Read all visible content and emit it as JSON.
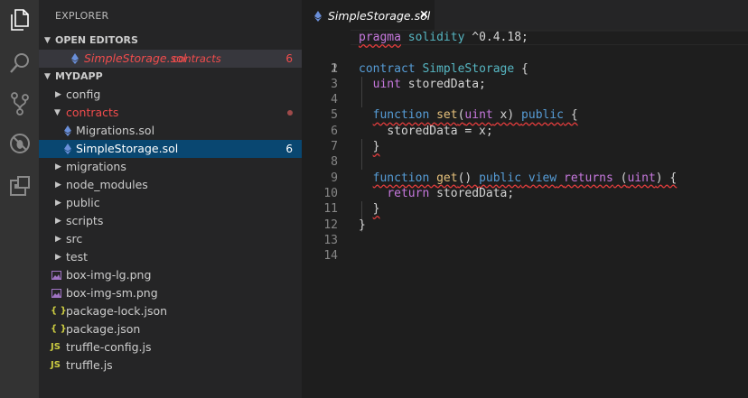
{
  "activity_bar": {
    "icons": [
      "files-icon",
      "search-icon",
      "source-control-icon",
      "debug-icon",
      "extensions-icon"
    ]
  },
  "explorer": {
    "title": "EXPLORER",
    "open_editors": {
      "header": "OPEN EDITORS",
      "items": [
        {
          "name": "SimpleStorage.sol",
          "folder": "contracts",
          "badge": "6"
        }
      ]
    },
    "project": {
      "header": "MYDAPP",
      "items": [
        {
          "label": "config",
          "type": "folder"
        },
        {
          "label": "contracts",
          "type": "folder-open"
        },
        {
          "label": "Migrations.sol",
          "type": "sol"
        },
        {
          "label": "SimpleStorage.sol",
          "type": "sol",
          "badge": "6"
        },
        {
          "label": "migrations",
          "type": "folder"
        },
        {
          "label": "node_modules",
          "type": "folder"
        },
        {
          "label": "public",
          "type": "folder"
        },
        {
          "label": "scripts",
          "type": "folder"
        },
        {
          "label": "src",
          "type": "folder"
        },
        {
          "label": "test",
          "type": "folder"
        },
        {
          "label": "box-img-lg.png",
          "type": "image"
        },
        {
          "label": "box-img-sm.png",
          "type": "image"
        },
        {
          "label": "package-lock.json",
          "type": "json"
        },
        {
          "label": "package.json",
          "type": "json"
        },
        {
          "label": "truffle-config.js",
          "type": "js"
        },
        {
          "label": "truffle.js",
          "type": "js"
        }
      ]
    },
    "icon_glyphs": {
      "json": "{ }",
      "js": "JS"
    }
  },
  "editor": {
    "tab": {
      "label": "SimpleStorage.sol",
      "close": "×"
    },
    "line_numbers": [
      "1",
      "2",
      "3",
      "4",
      "5",
      "6",
      "7",
      "8",
      "9",
      "10",
      "11",
      "12",
      "13",
      "14"
    ],
    "code": {
      "l1_pragma": "pragma",
      "l1_solidity": "solidity",
      "l1_version": " ^0.4.18;",
      "l3_contract": "contract",
      "l3_name": "SimpleStorage",
      "l3_brace": " {",
      "l4_uint": "uint",
      "l4_var": " storedData;",
      "l6_function": "function",
      "l6_name": "set",
      "l6_open": "(",
      "l6_uint": "uint",
      "l6_param": " x) ",
      "l6_public": "public",
      "l6_brace": " {",
      "l7_body": "storedData = x;",
      "l8_close": "}",
      "l10_function": "function",
      "l10_name": "get",
      "l10_paren": "() ",
      "l10_public": "public",
      "l10_view": "view",
      "l10_returns": "returns",
      "l10_open": " (",
      "l10_uint": "uint",
      "l10_close": ") {",
      "l11_return": "return",
      "l11_var": " storedData;",
      "l12_close": "}",
      "l13_close": "}"
    }
  },
  "colors": {
    "error": "#f14c4c",
    "keyword": "#c678dd",
    "storage": "#569cd6",
    "type": "#56b6c2",
    "function": "#e5c07b"
  }
}
